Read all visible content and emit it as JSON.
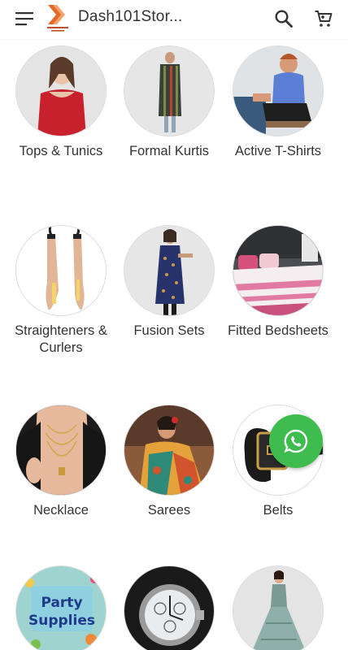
{
  "header": {
    "store_name": "Dash101Stor...",
    "menu_icon": "menu-icon",
    "search_icon": "search-icon",
    "cart_icon": "cart-icon",
    "logo": "store-logo"
  },
  "categories": [
    {
      "label": "Tops & Tunics",
      "image": "woman-red-sweater"
    },
    {
      "label": "Formal Kurtis",
      "image": "woman-striped-kurti"
    },
    {
      "label": "Active T-Shirts",
      "image": "man-blue-tshirt"
    },
    {
      "label": "Straighteners & Curlers",
      "image": "hair-straightener"
    },
    {
      "label": "Fusion Sets",
      "image": "woman-blue-kurta"
    },
    {
      "label": "Fitted Bedsheets",
      "image": "bed-pink-sheets"
    },
    {
      "label": "Necklace",
      "image": "gold-necklace"
    },
    {
      "label": "Sarees",
      "image": "woman-colorful-saree"
    },
    {
      "label": "Belts",
      "image": "black-leather-belt"
    },
    {
      "label": "",
      "image": "party-supplies-sign",
      "image_text": [
        "Party",
        "Supplies"
      ]
    },
    {
      "label": "",
      "image": "silver-wristwatch"
    },
    {
      "label": "",
      "image": "woman-grey-lehenga"
    }
  ],
  "floating": {
    "icon": "whatsapp-icon",
    "color": "#3ebd4e"
  },
  "colors": {
    "accent": "#e36a2a",
    "text": "#333333",
    "whatsapp": "#3ebd4e"
  }
}
